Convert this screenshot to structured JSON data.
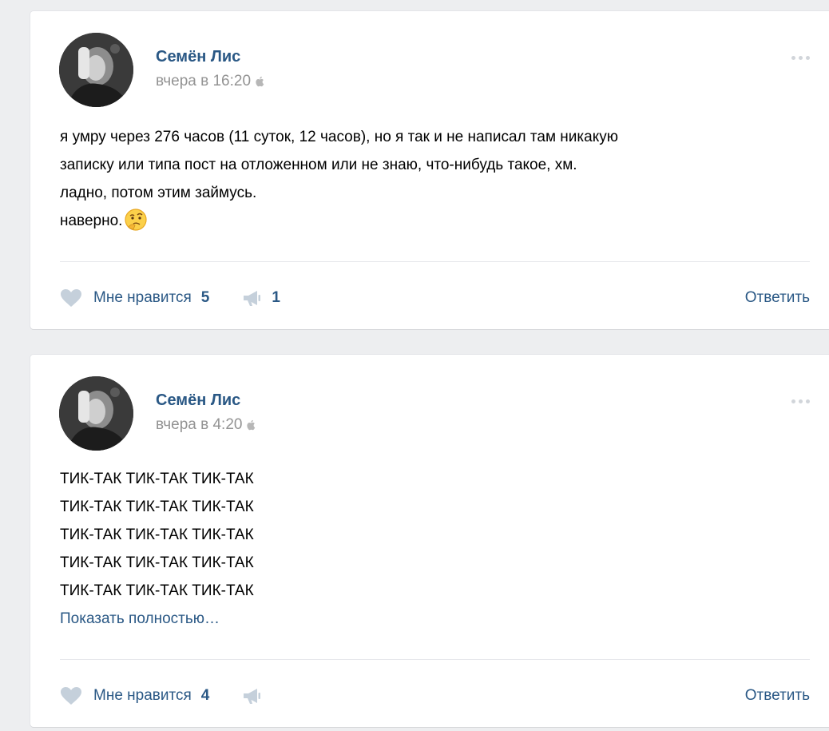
{
  "posts": [
    {
      "author": "Семён Лис",
      "date": "вчера в 16:20",
      "lines": [
        "я умру через 276 часов (11 суток, 12 часов), но я так и не написал там никакую",
        "записку или типа пост на отложенном или не знаю, что-нибудь такое, хм.",
        "ладно, потом этим займусь.",
        "наверно."
      ],
      "emoji": "thinking-face-emoji",
      "like_label": "Мне нравится",
      "like_count": "5",
      "share_count": "1",
      "reply_label": "Ответить"
    },
    {
      "author": "Семён Лис",
      "date": "вчера в 4:20",
      "lines": [
        "ТИК-ТАК ТИК-ТАК ТИК-ТАК",
        "ТИК-ТАК ТИК-ТАК ТИК-ТАК",
        "ТИК-ТАК ТИК-ТАК ТИК-ТАК",
        "ТИК-ТАК ТИК-ТАК ТИК-ТАК",
        "ТИК-ТАК ТИК-ТАК ТИК-ТАК"
      ],
      "show_more": "Показать полностью…",
      "like_label": "Мне нравится",
      "like_count": "4",
      "share_count": "",
      "reply_label": "Ответить"
    }
  ],
  "colors": {
    "link": "#2a5885",
    "meta": "#939393",
    "icon": "#c5d0db",
    "background": "#edeef0"
  }
}
